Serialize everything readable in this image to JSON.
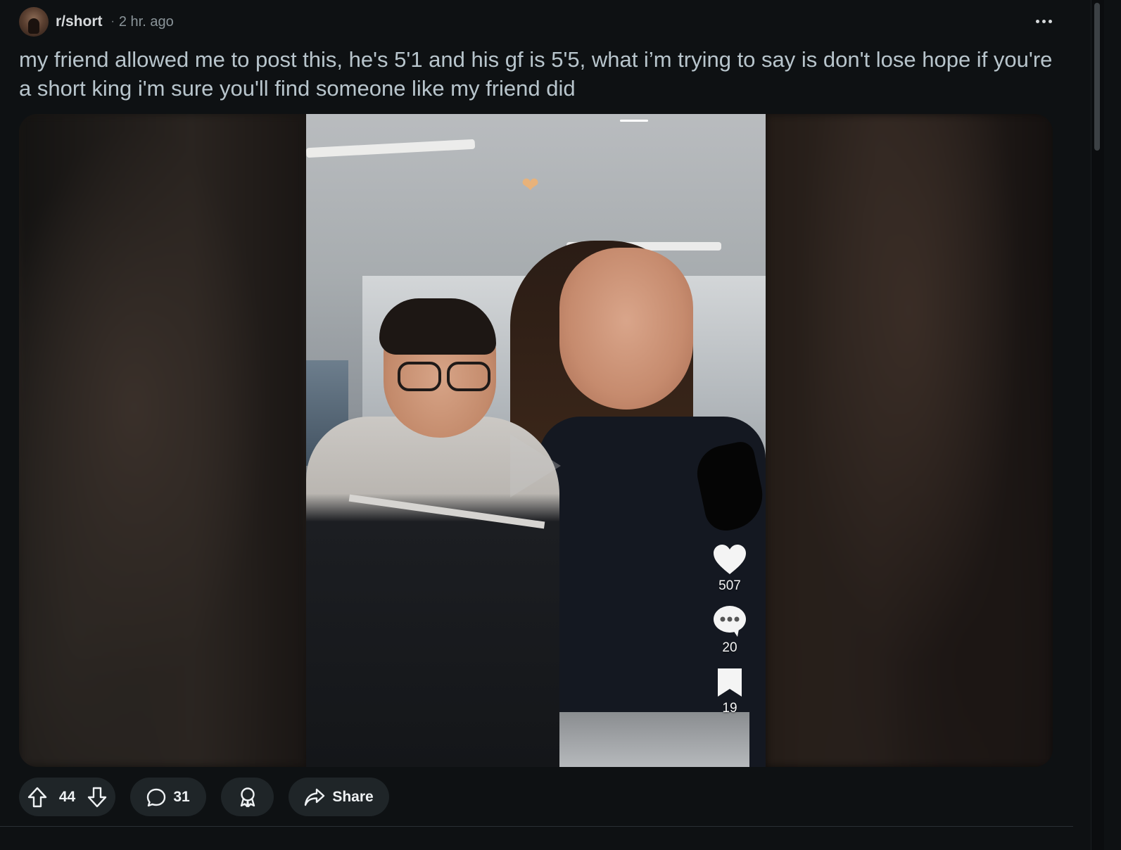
{
  "post": {
    "subreddit": "r/short",
    "separator": "·",
    "time": "2 hr. ago",
    "title": "my friend allowed me to post this, he's 5'1 and his gf is 5'5, what i’m trying to say is don't lose hope if you're a short king i'm sure you'll find someone like my friend did",
    "more_icon": "more-horizontal-icon"
  },
  "video_overlay": {
    "likes": "507",
    "comments": "20",
    "saves": "19"
  },
  "actions": {
    "votes": "44",
    "comments": "31",
    "share_label": "Share"
  },
  "colors": {
    "background": "#0e1113",
    "pill": "#1f2528",
    "title_text": "#b8c5cc",
    "meta_text": "#8a9499"
  }
}
